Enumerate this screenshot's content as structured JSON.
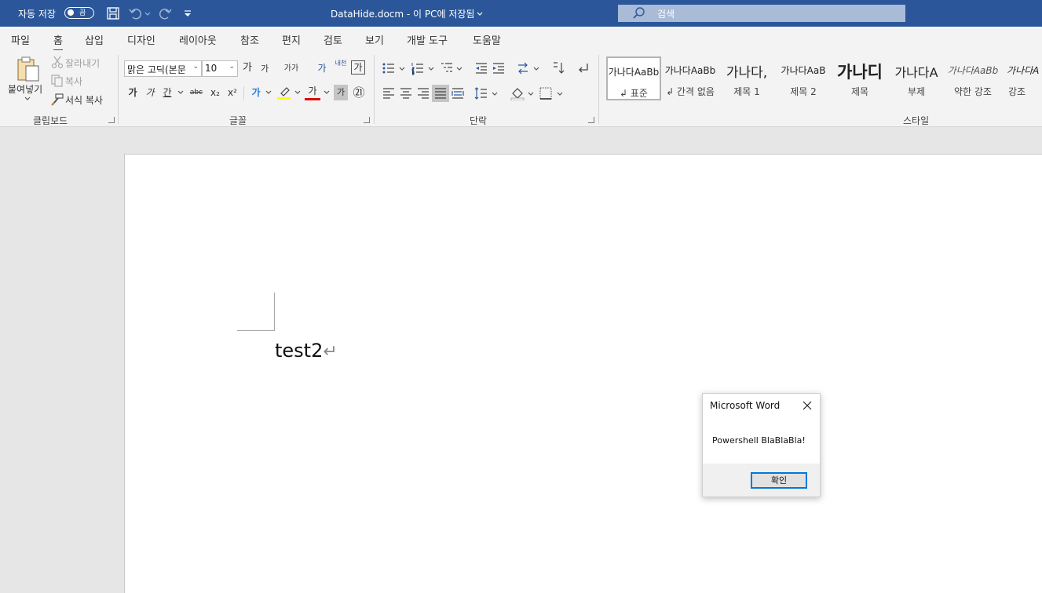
{
  "titlebar": {
    "autosave_label": "자동 저장",
    "autosave_state": "끔",
    "doc_title": "DataHide.docm  -  이 PC에 저장됨",
    "search_placeholder": "검색"
  },
  "menu": {
    "tabs": [
      "파일",
      "홈",
      "삽입",
      "디자인",
      "레이아웃",
      "참조",
      "편지",
      "검토",
      "보기",
      "개발 도구",
      "도움말"
    ],
    "active": "홈"
  },
  "ribbon": {
    "clipboard": {
      "paste": "붙여넣기",
      "cut": "잘라내기",
      "copy": "복사",
      "format_painter": "서식 복사",
      "group": "클립보드"
    },
    "font": {
      "font_name": "맑은 고딕(본문",
      "font_size": "10",
      "group": "글꼴",
      "grow": "가",
      "shrink": "가",
      "case": "가가",
      "bold": "가",
      "italic": "가",
      "underline": "간",
      "strike": "abc",
      "sub": "x₂",
      "sup": "x²",
      "effects": "가",
      "highlight": "가",
      "color": "가",
      "shade": "가",
      "enclose": "㉑",
      "phonetic": "내천",
      "border_char": "가"
    },
    "paragraph": {
      "group": "단락"
    },
    "styles": {
      "group": "스타일",
      "items": [
        {
          "preview": "가나다AaBb",
          "name": "↲ 표준"
        },
        {
          "preview": "가나다AaBb",
          "name": "↲ 간격 없음"
        },
        {
          "preview": "가나다,",
          "name": "제목 1"
        },
        {
          "preview": "가나다AaB",
          "name": "제목 2"
        },
        {
          "preview": "가나디",
          "name": "제목"
        },
        {
          "preview": "가나다A",
          "name": "부제"
        },
        {
          "preview": "가나다AaBb",
          "name": "약한 강조"
        },
        {
          "preview": "가나다A",
          "name": "강조"
        }
      ]
    }
  },
  "document": {
    "text": "test2",
    "pilcrow": "↵"
  },
  "dialog": {
    "title": "Microsoft Word",
    "message": "Powershell BlaBlaBla!",
    "ok": "확인"
  }
}
